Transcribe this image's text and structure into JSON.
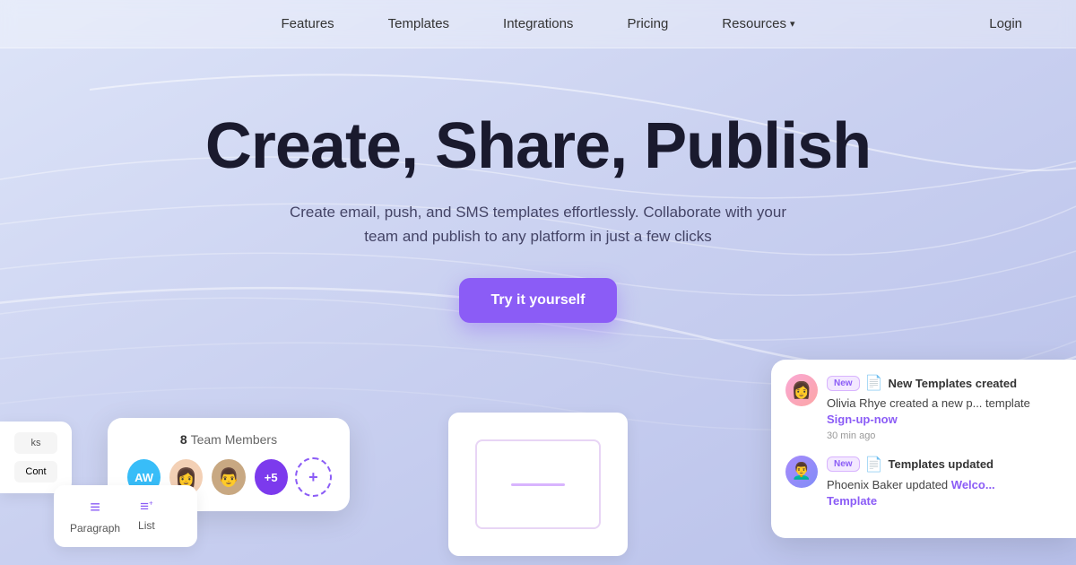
{
  "nav": {
    "links": [
      {
        "label": "Features",
        "id": "features"
      },
      {
        "label": "Templates",
        "id": "templates"
      },
      {
        "label": "Integrations",
        "id": "integrations"
      },
      {
        "label": "Pricing",
        "id": "pricing"
      },
      {
        "label": "Resources",
        "id": "resources",
        "hasChevron": true
      }
    ],
    "login_label": "Login"
  },
  "hero": {
    "title": "Create, Share, Publish",
    "subtitle": "Create email, push, and SMS templates effortlessly. Collaborate with your team and publish to any platform in just a few clicks",
    "cta_label": "Try it yourself"
  },
  "team_card": {
    "count": "8",
    "label": "Team Members",
    "avatars": [
      "AW",
      "👩",
      "👨",
      "+5"
    ],
    "add_label": "Add member",
    "tooltip": "Add member"
  },
  "paragraph_card": {
    "items": [
      {
        "icon": "≡",
        "label": "Paragraph"
      },
      {
        "icon": "≡+",
        "label": "List"
      }
    ]
  },
  "left_edge": {
    "items": [
      "ks",
      "Cont"
    ]
  },
  "notifications": {
    "items": [
      {
        "badge": "New",
        "icon": "📄",
        "title": "New Templates created",
        "author": "Olivia Rhye",
        "text": "created a new p... template",
        "link": "Sign-up-now",
        "time": "30 min ago"
      },
      {
        "badge": "New",
        "icon": "📄",
        "title": "Templates updated",
        "author": "Phoenix Baker",
        "text": "updated",
        "link": "Welco... Template",
        "time": ""
      }
    ]
  }
}
